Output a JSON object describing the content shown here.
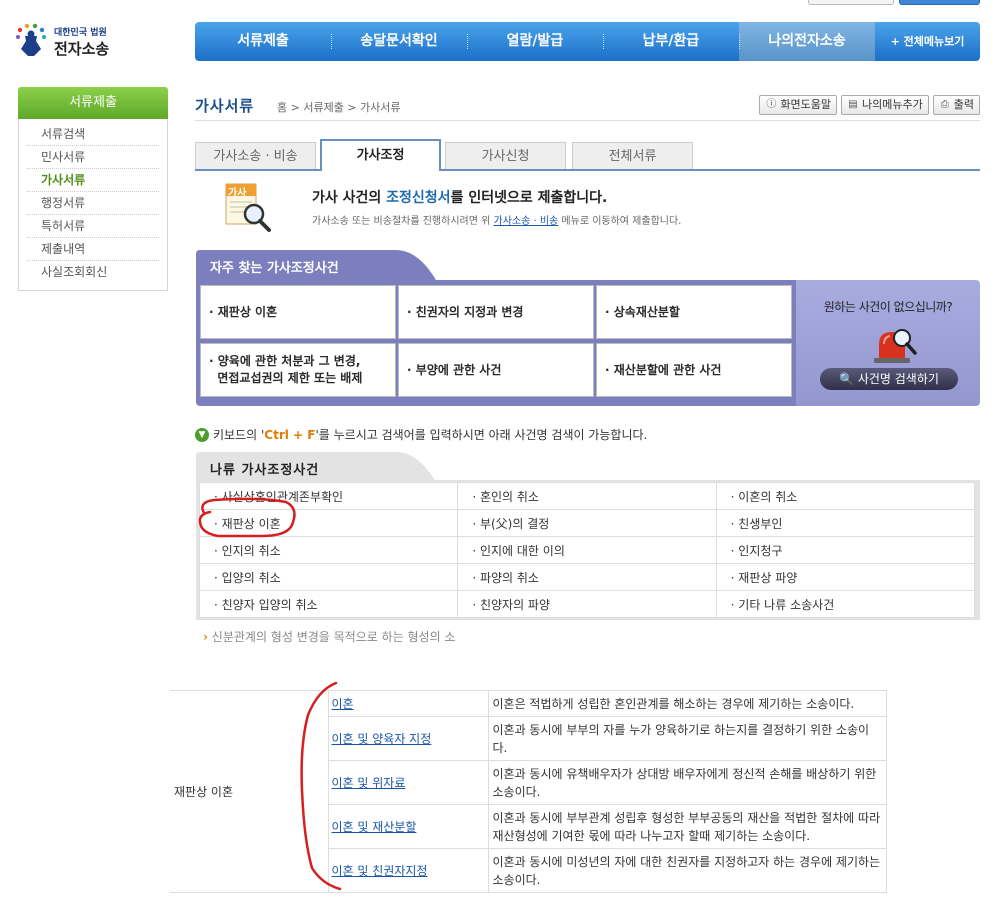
{
  "logo": {
    "org": "대한민국 법원",
    "name": "전자소송"
  },
  "topnav": {
    "items": [
      "서류제출",
      "송달문서확인",
      "열람/발급",
      "납부/환급",
      "나의전자소송"
    ],
    "more": "+ 전체메뉴보기"
  },
  "sidebar": {
    "title": "서류제출",
    "items": [
      "서류검색",
      "민사서류",
      "가사서류",
      "행정서류",
      "특허서류",
      "제출내역",
      "사실조회회신"
    ]
  },
  "page": {
    "title": "가사서류",
    "breadcrumb": "홈 > 서류제출 > 가사서류",
    "tools": [
      "화면도움말",
      "나의메뉴추가",
      "출력"
    ]
  },
  "tabs": [
    "가사소송 · 비송",
    "가사조정",
    "가사신청",
    "전체서류"
  ],
  "intro": {
    "title_pre": "가사 사건의 ",
    "title_hl": "조정신청서",
    "title_post": "를 인터넷으로 제출합니다.",
    "sub_pre": "가사소송 또는 비송절차를 진행하시려면 위 ",
    "sub_link": "가사소송 · 비송",
    "sub_post": " 메뉴로 이동하여 제출합니다.",
    "icon_label": "가사"
  },
  "frequent": {
    "title": "자주 찾는 가사조정사건",
    "items": [
      "· 재판상 이혼",
      "· 친권자의 지정과 변경",
      "· 상속재산분할",
      "· 양육에 관한 처분과 그 변경,\n  면접교섭권의 제한 또는 배제",
      "· 부양에 관한 사건",
      "· 재산분할에 관한 사건"
    ],
    "side_question": "원하는 사건이 없으십니까?",
    "search_button": "사건명 검색하기"
  },
  "keyboard_hint": {
    "pre": "키보드의 '",
    "key": "Ctrl + F",
    "post": "'를 누르시고 검색어를 입력하시면 아래 사건명 검색이 가능합니다."
  },
  "category": {
    "title": "나류 가사조정사건",
    "rows": [
      [
        "· 사실상혼인관계존부확인",
        "· 혼인의 취소",
        "· 이혼의 취소"
      ],
      [
        "· 재판상 이혼",
        "· 부(父)의 결정",
        "· 친생부인"
      ],
      [
        "· 인지의 취소",
        "· 인지에 대한 이의",
        "· 인지청구"
      ],
      [
        "· 입양의 취소",
        "· 파양의 취소",
        "· 재판상 파양"
      ],
      [
        "· 친양자 입양의 취소",
        "· 친양자의 파양",
        "· 기타 나류 소송사건"
      ]
    ],
    "note": "신분관계의 형성 변경을 목적으로 하는 형성의 소"
  },
  "detail": {
    "row_head": "재판상 이혼",
    "rows": [
      {
        "link": "이혼",
        "desc": "이혼은 적법하게 성립한 혼인관계를 해소하는 경우에 제기하는 소송이다."
      },
      {
        "link": "이혼 및 양육자 지정",
        "desc": "이혼과 동시에 부부의 자를 누가 양육하기로 하는지를 결정하기 위한 소송이다."
      },
      {
        "link": "이혼 및 위자료",
        "desc": "이혼과 동시에 유책배우자가 상대방 배우자에게 정신적 손해를 배상하기 위한 소송이다."
      },
      {
        "link": "이혼 및 재산분할",
        "desc": "이혼과 동시에 부부관계 성립후 형성한 부부공동의 재산을 적법한 절차에 따라 재산형성에 기여한 몫에 따라 나누고자 할때 제기하는 소송이다."
      },
      {
        "link": "이혼 및 친권자지정",
        "desc": "이혼과 동시에 미성년의 자에 대한 친권자를 지정하고자 하는 경우에 제기하는 소송이다."
      }
    ]
  },
  "colors": {
    "nav_blue": "#1d6fc8",
    "sidebar_green": "#5fa82a",
    "freq_purple": "#7c7fbd",
    "annotation_red": "#d42020"
  }
}
